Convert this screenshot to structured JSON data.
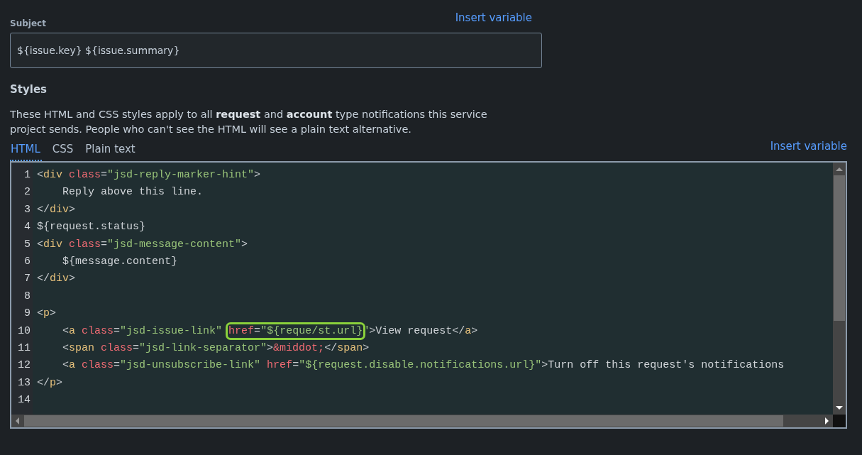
{
  "subject": {
    "label": "Subject",
    "insert_link": "Insert variable",
    "value": "${issue.key} ${issue.summary}"
  },
  "styles": {
    "heading": "Styles",
    "description": "These HTML and CSS styles apply to all **request** and **account** type notifications this service project sends. People who can't see the HTML will see a plain text alternative."
  },
  "tabs": [
    {
      "label": "HTML",
      "selected": true
    },
    {
      "label": "CSS",
      "selected": false
    },
    {
      "label": "Plain text",
      "selected": false
    }
  ],
  "insert_link": "Insert variable",
  "editor": {
    "lines": [
      {
        "number": "1",
        "tokens": [
          {
            "kind": "punct",
            "text": "<"
          },
          {
            "kind": "tag",
            "text": "div"
          },
          {
            "kind": "attr",
            "text": " class"
          },
          {
            "kind": "punct",
            "text": "="
          },
          {
            "kind": "string",
            "text": "\"jsd-reply-marker-hint\""
          },
          {
            "kind": "punct",
            "text": ">"
          }
        ]
      },
      {
        "number": "2",
        "tokens": [
          {
            "kind": "text",
            "text": "    Reply above this line."
          }
        ]
      },
      {
        "number": "3",
        "tokens": [
          {
            "kind": "punct",
            "text": "</"
          },
          {
            "kind": "tag",
            "text": "div"
          },
          {
            "kind": "punct",
            "text": ">"
          }
        ]
      },
      {
        "number": "4",
        "tokens": [
          {
            "kind": "text",
            "text": "${request.status}"
          }
        ]
      },
      {
        "number": "5",
        "tokens": [
          {
            "kind": "punct",
            "text": "<"
          },
          {
            "kind": "tag",
            "text": "div"
          },
          {
            "kind": "attr",
            "text": " class"
          },
          {
            "kind": "punct",
            "text": "="
          },
          {
            "kind": "string",
            "text": "\"jsd-message-content\""
          },
          {
            "kind": "punct",
            "text": ">"
          }
        ]
      },
      {
        "number": "6",
        "tokens": [
          {
            "kind": "text",
            "text": "    ${message.content}"
          }
        ]
      },
      {
        "number": "7",
        "tokens": [
          {
            "kind": "punct",
            "text": "</"
          },
          {
            "kind": "tag",
            "text": "div"
          },
          {
            "kind": "punct",
            "text": ">"
          }
        ]
      },
      {
        "number": "8"
      },
      {
        "number": "9",
        "tokens": [
          {
            "kind": "punct",
            "text": "<"
          },
          {
            "kind": "tag",
            "text": "p"
          },
          {
            "kind": "punct",
            "text": ">"
          }
        ]
      },
      {
        "number": "10",
        "tokens": [
          {
            "kind": "punct",
            "text": "    <"
          },
          {
            "kind": "tag",
            "text": "a"
          },
          {
            "kind": "attr",
            "text": " class"
          },
          {
            "kind": "punct",
            "text": "="
          },
          {
            "kind": "string",
            "text": "\"jsd-issue-link\" "
          },
          {
            "kind": "highlight",
            "tokens": [
              {
                "kind": "attr",
                "text": "href"
              },
              {
                "kind": "punct",
                "text": "="
              },
              {
                "kind": "string",
                "text": "\"${reque/st.url}"
              }
            ]
          },
          {
            "kind": "string",
            "text": "\""
          },
          {
            "kind": "punct",
            "text": ">"
          },
          {
            "kind": "text",
            "text": "View request"
          },
          {
            "kind": "punct",
            "text": "</"
          },
          {
            "kind": "tag",
            "text": "a"
          },
          {
            "kind": "punct",
            "text": ">"
          }
        ]
      },
      {
        "number": "11",
        "tokens": [
          {
            "kind": "punct",
            "text": "    <"
          },
          {
            "kind": "tag",
            "text": "span"
          },
          {
            "kind": "attr",
            "text": " class"
          },
          {
            "kind": "punct",
            "text": "="
          },
          {
            "kind": "string",
            "text": "\"jsd-link-separator\""
          },
          {
            "kind": "punct",
            "text": ">"
          },
          {
            "kind": "entity",
            "text": "&middot;"
          },
          {
            "kind": "punct",
            "text": "</"
          },
          {
            "kind": "tag",
            "text": "span"
          },
          {
            "kind": "punct",
            "text": ">"
          }
        ]
      },
      {
        "number": "12",
        "tokens": [
          {
            "kind": "punct",
            "text": "    <"
          },
          {
            "kind": "tag",
            "text": "a"
          },
          {
            "kind": "attr",
            "text": " class"
          },
          {
            "kind": "punct",
            "text": "="
          },
          {
            "kind": "string",
            "text": "\"jsd-unsubscribe-link\""
          },
          {
            "kind": "attr",
            "text": " href"
          },
          {
            "kind": "punct",
            "text": "="
          },
          {
            "kind": "string",
            "text": "\"${request.disable.notifications.url}\""
          },
          {
            "kind": "punct",
            "text": ">"
          },
          {
            "kind": "text",
            "text": "Turn off this request's notifications"
          }
        ]
      },
      {
        "number": "13",
        "tokens": [
          {
            "kind": "punct",
            "text": "</"
          },
          {
            "kind": "tag",
            "text": "p"
          },
          {
            "kind": "punct",
            "text": ">"
          }
        ]
      },
      {
        "number": "14"
      }
    ]
  }
}
